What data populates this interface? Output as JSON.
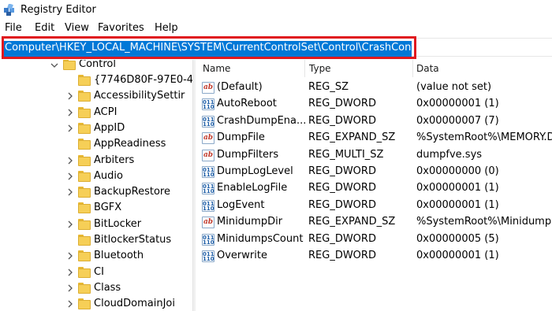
{
  "window": {
    "title": "Registry Editor"
  },
  "menu": [
    "File",
    "Edit",
    "View",
    "Favorites",
    "Help"
  ],
  "address": {
    "path": "Computer\\HKEY_LOCAL_MACHINE\\SYSTEM\\CurrentControlSet\\Control\\CrashControl"
  },
  "tree": {
    "parent": {
      "label": "Control",
      "expanded": true
    },
    "children": [
      {
        "label": "{7746D80F-97E0-4",
        "has_children": false
      },
      {
        "label": "AccessibilitySettir",
        "has_children": true
      },
      {
        "label": "ACPI",
        "has_children": true
      },
      {
        "label": "AppID",
        "has_children": true
      },
      {
        "label": "AppReadiness",
        "has_children": false
      },
      {
        "label": "Arbiters",
        "has_children": true
      },
      {
        "label": "Audio",
        "has_children": true
      },
      {
        "label": "BackupRestore",
        "has_children": true
      },
      {
        "label": "BGFX",
        "has_children": false
      },
      {
        "label": "BitLocker",
        "has_children": true
      },
      {
        "label": "BitlockerStatus",
        "has_children": false
      },
      {
        "label": "Bluetooth",
        "has_children": true
      },
      {
        "label": "CI",
        "has_children": true
      },
      {
        "label": "Class",
        "has_children": true
      },
      {
        "label": "CloudDomainJoi",
        "has_children": true
      }
    ]
  },
  "list": {
    "columns": [
      "Name",
      "Type",
      "Data"
    ],
    "rows": [
      {
        "icon": "string-value-icon",
        "kind": "sz",
        "name": "(Default)",
        "type": "REG_SZ",
        "data": "(value not set)"
      },
      {
        "icon": "binary-value-icon",
        "kind": "bin",
        "name": "AutoReboot",
        "type": "REG_DWORD",
        "data": "0x00000001 (1)"
      },
      {
        "icon": "binary-value-icon",
        "kind": "bin",
        "name": "CrashDumpEna...",
        "type": "REG_DWORD",
        "data": "0x00000007 (7)"
      },
      {
        "icon": "string-value-icon",
        "kind": "sz",
        "name": "DumpFile",
        "type": "REG_EXPAND_SZ",
        "data": "%SystemRoot%\\MEMORY.DM"
      },
      {
        "icon": "string-value-icon",
        "kind": "sz",
        "name": "DumpFilters",
        "type": "REG_MULTI_SZ",
        "data": "dumpfve.sys"
      },
      {
        "icon": "binary-value-icon",
        "kind": "bin",
        "name": "DumpLogLevel",
        "type": "REG_DWORD",
        "data": "0x00000000 (0)"
      },
      {
        "icon": "binary-value-icon",
        "kind": "bin",
        "name": "EnableLogFile",
        "type": "REG_DWORD",
        "data": "0x00000001 (1)"
      },
      {
        "icon": "binary-value-icon",
        "kind": "bin",
        "name": "LogEvent",
        "type": "REG_DWORD",
        "data": "0x00000001 (1)"
      },
      {
        "icon": "string-value-icon",
        "kind": "sz",
        "name": "MinidumpDir",
        "type": "REG_EXPAND_SZ",
        "data": "%SystemRoot%\\Minidump"
      },
      {
        "icon": "binary-value-icon",
        "kind": "bin",
        "name": "MinidumpsCount",
        "type": "REG_DWORD",
        "data": "0x00000005 (5)"
      },
      {
        "icon": "binary-value-icon",
        "kind": "bin",
        "name": "Overwrite",
        "type": "REG_DWORD",
        "data": "0x00000001 (1)"
      }
    ]
  },
  "colors": {
    "selection": "#0078d7",
    "annotation_box": "#e0191f",
    "folder": "#f6cf57"
  }
}
